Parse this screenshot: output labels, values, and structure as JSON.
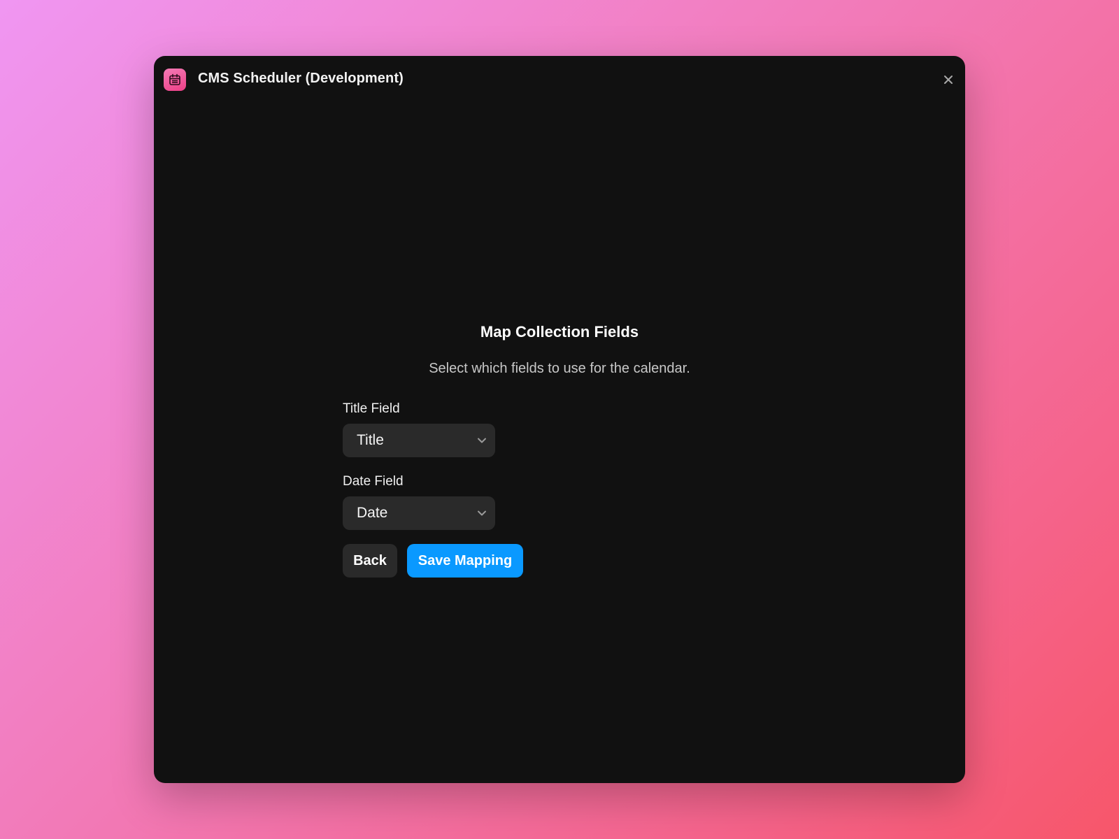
{
  "window": {
    "title": "CMS Scheduler (Development)",
    "app_icon": "calendar-icon",
    "close_icon": "close-icon"
  },
  "main": {
    "heading": "Map Collection Fields",
    "subheading": "Select which fields to use for the calendar.",
    "fields": [
      {
        "label": "Title Field",
        "value": "Title"
      },
      {
        "label": "Date Field",
        "value": "Date"
      }
    ],
    "buttons": {
      "back_label": "Back",
      "save_label": "Save Mapping"
    }
  },
  "colors": {
    "window_bg": "#111111",
    "control_bg": "#2a2a2a",
    "accent": "#0a99ff",
    "app_icon_pink": "#ec3f86"
  }
}
